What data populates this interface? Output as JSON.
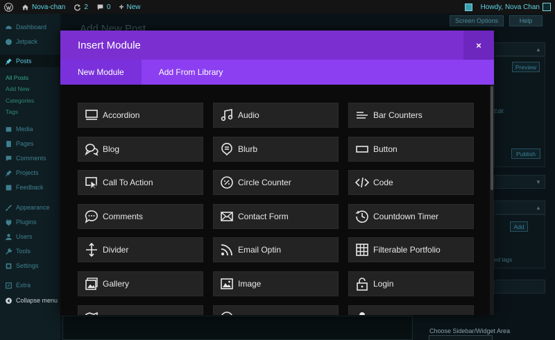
{
  "admin_bar": {
    "site_name": "Nova-chan",
    "updates_count": "2",
    "comments_count": "0",
    "new_label": "New",
    "greeting": "Howdy, Nova Chan"
  },
  "sidebar": {
    "items": [
      {
        "label": "Dashboard",
        "icon": "dashboard-icon"
      },
      {
        "label": "Jetpack",
        "icon": "jetpack-icon"
      },
      {
        "label": "Posts",
        "icon": "pin-icon"
      },
      {
        "label": "Media",
        "icon": "media-icon"
      },
      {
        "label": "Pages",
        "icon": "pages-icon"
      },
      {
        "label": "Comments",
        "icon": "comments-icon"
      },
      {
        "label": "Projects",
        "icon": "pin-icon"
      },
      {
        "label": "Feedback",
        "icon": "feedback-icon"
      },
      {
        "label": "Appearance",
        "icon": "brush-icon"
      },
      {
        "label": "Plugins",
        "icon": "plugin-icon"
      },
      {
        "label": "Users",
        "icon": "users-icon"
      },
      {
        "label": "Tools",
        "icon": "tools-icon"
      },
      {
        "label": "Settings",
        "icon": "settings-icon"
      },
      {
        "label": "Extra",
        "icon": "extra-icon"
      },
      {
        "label": "Collapse menu",
        "icon": "collapse-icon"
      }
    ],
    "posts_submenu": [
      "All Posts",
      "Add New",
      "Categories",
      "Tags"
    ]
  },
  "background": {
    "page_title": "Add New Post",
    "screen_options": "Screen Options",
    "help": "Help",
    "preview": "Preview",
    "publish": "Publish",
    "add": "Add",
    "sidebar_label": "Choose Sidebar/Widget Area",
    "edit_fragment": "Edit",
    "tags_fragment": "ed tags"
  },
  "modal": {
    "title": "Insert Module",
    "close_symbol": "×",
    "tabs": [
      "New Module",
      "Add From Library"
    ],
    "modules": [
      {
        "label": "Accordion",
        "icon": "accordion-icon"
      },
      {
        "label": "Audio",
        "icon": "audio-icon"
      },
      {
        "label": "Bar Counters",
        "icon": "bar-counters-icon"
      },
      {
        "label": "Blog",
        "icon": "blog-icon"
      },
      {
        "label": "Blurb",
        "icon": "blurb-icon"
      },
      {
        "label": "Button",
        "icon": "button-icon"
      },
      {
        "label": "Call To Action",
        "icon": "call-to-action-icon"
      },
      {
        "label": "Circle Counter",
        "icon": "circle-counter-icon"
      },
      {
        "label": "Code",
        "icon": "code-icon"
      },
      {
        "label": "Comments",
        "icon": "comments-icon"
      },
      {
        "label": "Contact Form",
        "icon": "contact-form-icon"
      },
      {
        "label": "Countdown Timer",
        "icon": "countdown-timer-icon"
      },
      {
        "label": "Divider",
        "icon": "divider-icon"
      },
      {
        "label": "Email Optin",
        "icon": "email-optin-icon"
      },
      {
        "label": "Filterable Portfolio",
        "icon": "filterable-portfolio-icon"
      },
      {
        "label": "Gallery",
        "icon": "gallery-icon"
      },
      {
        "label": "Image",
        "icon": "image-icon"
      },
      {
        "label": "Login",
        "icon": "login-icon"
      }
    ]
  },
  "colors": {
    "modal_header": "#7b2fd1",
    "tabs_bar": "#8b3ff0",
    "module_button": "#232323",
    "admin_link": "#5fd3e6"
  }
}
